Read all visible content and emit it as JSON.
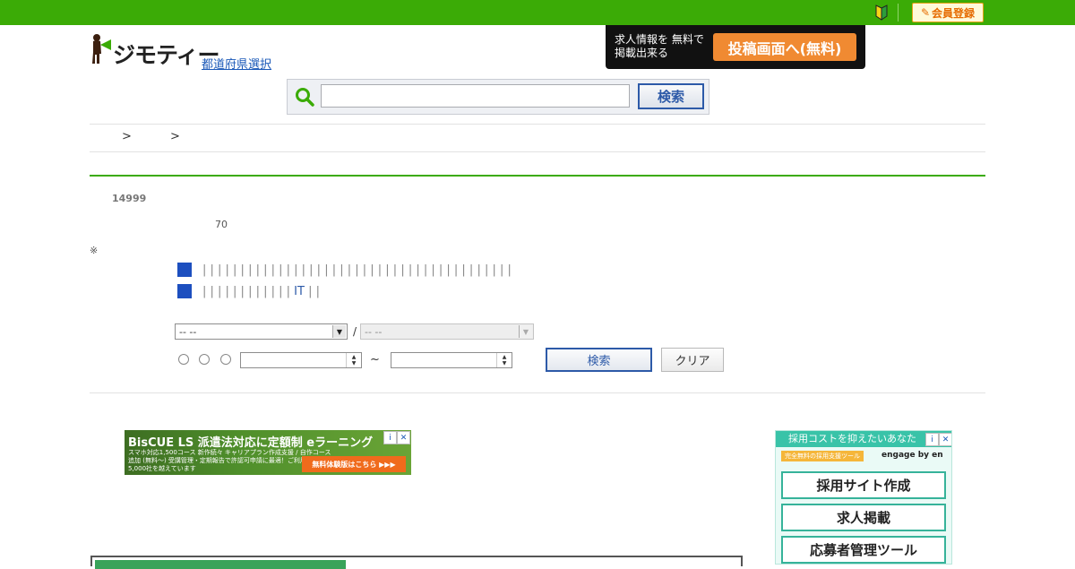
{
  "header": {
    "beginner_icon": "beginner-mark-icon",
    "register_label": "会員登録",
    "register_icon": "pencil-icon"
  },
  "logo": {
    "text": "ジモティー"
  },
  "pref_link": "都道府県選択",
  "ad_banner": {
    "text": "求人情報を 無料で掲載出来る",
    "button": "投稿画面へ(無料)"
  },
  "search": {
    "value": "",
    "placeholder": "",
    "button": "検索"
  },
  "breadcrumb": [
    ">",
    ">"
  ],
  "results": {
    "count": "14999",
    "sub_count": "70",
    "note_mark": "※"
  },
  "filters": {
    "row1_pipes": "| | | | | | | | | | | | | | | | | | | | | | | | | | | | | | | | | | | | | | | | |",
    "row2_pipes": "| | | | | | | | | | | |",
    "row2_it": "IT",
    "row2_tail": "| |",
    "select1_value": "--  --",
    "select_sep": "/",
    "select2_value": "--  --",
    "tilde": "~",
    "search_button": "検索",
    "clear_button": "クリア"
  },
  "ads": {
    "left_title": "BisCUE LS 派遣法対応に定額制 eラーニング",
    "left_sub": "スマホ対応1,500コース 新作続々 キャリアプラン作成支援 / 自作コース追加 (無料～) 受講管理・定期報告で許認可申請に最適！ご利用企業様5,000社を越えています",
    "left_cta": "無料体験版はこちら ▶▶▶",
    "right_head": "採用コストを抑えたいあなた",
    "right_tag": "完全無料の採用支援ツール",
    "right_brand": "engage by en",
    "right_buttons": [
      "採用サイト作成",
      "求人掲載",
      "応募者管理ツール"
    ],
    "adchoice_i": "i",
    "adchoice_x": "✕"
  },
  "colors": {
    "brand_green": "#3bab06",
    "accent_blue": "#2d5aa8",
    "orange": "#f08a32"
  }
}
